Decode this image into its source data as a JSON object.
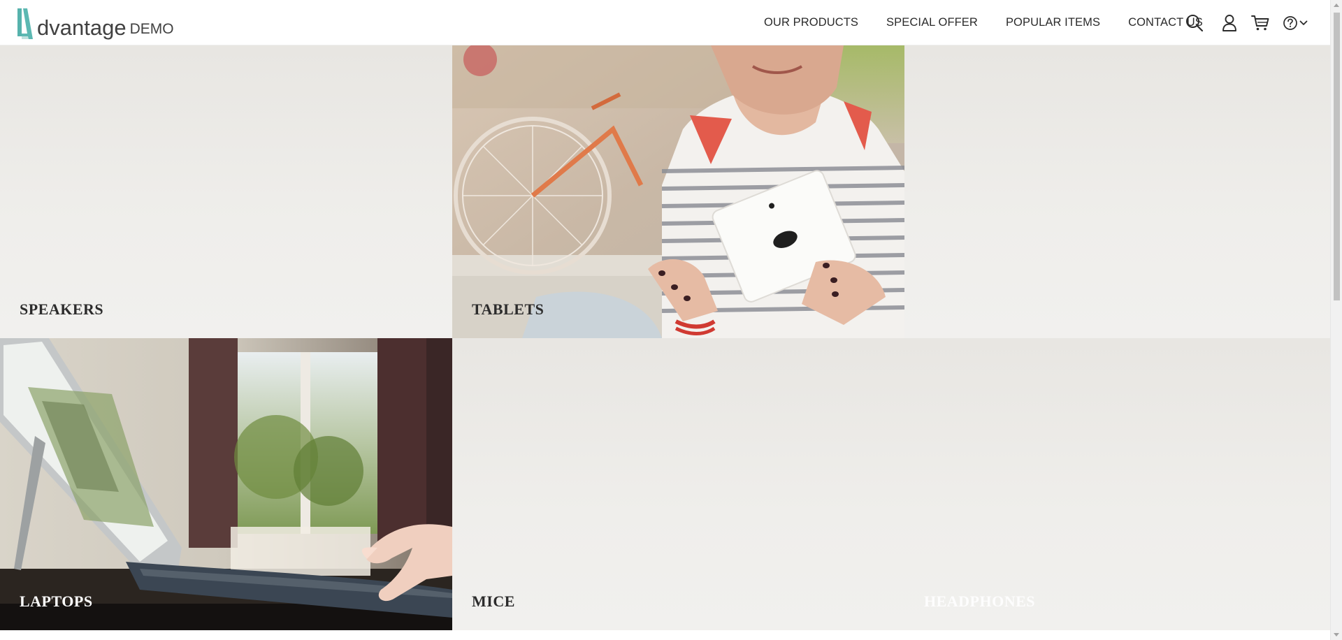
{
  "brand": {
    "name": "dvantage",
    "suffix": "DEMO",
    "accent_color": "#5cb8b2"
  },
  "nav": {
    "items": [
      {
        "label": "OUR PRODUCTS"
      },
      {
        "label": "SPECIAL OFFER"
      },
      {
        "label": "POPULAR ITEMS"
      },
      {
        "label": "CONTACT US"
      }
    ]
  },
  "header_icons": [
    "search-icon",
    "user-icon",
    "cart-icon",
    "help-icon",
    "chevron-down-icon"
  ],
  "categories": [
    {
      "label": "SPEAKERS",
      "has_photo": false
    },
    {
      "label": "TABLETS",
      "has_photo": true
    },
    {
      "label": "",
      "has_photo": false
    },
    {
      "label": "LAPTOPS",
      "has_photo": true
    },
    {
      "label": "MICE",
      "has_photo": false
    },
    {
      "label": "HEADPHONES",
      "has_photo": false
    }
  ]
}
